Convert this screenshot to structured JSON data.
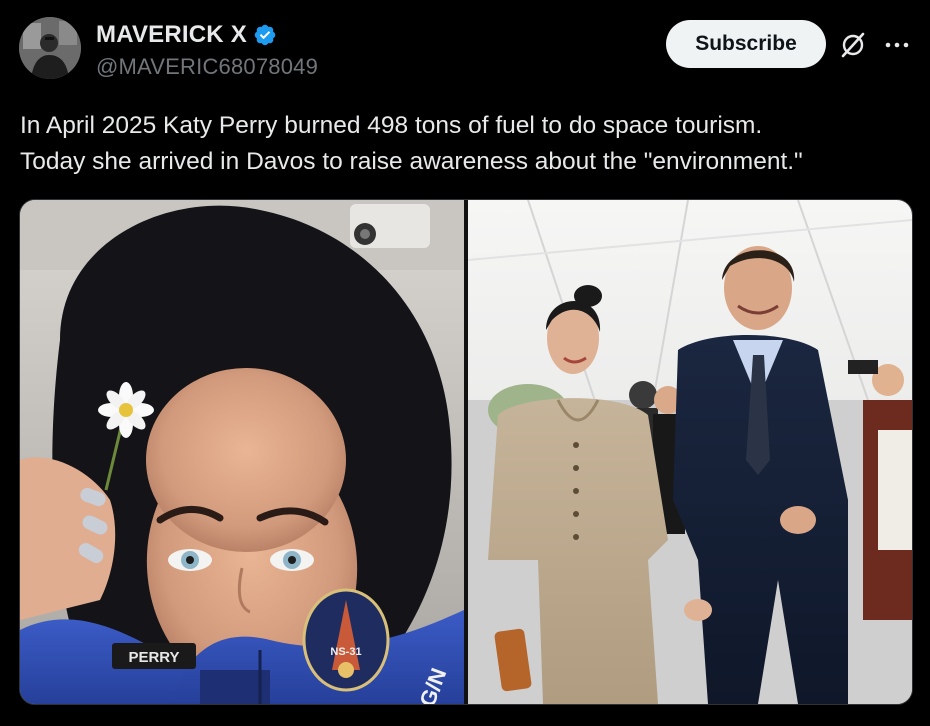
{
  "post": {
    "author": {
      "display_name": "MAVERICK X",
      "handle": "@MAVERIC68078049",
      "verified": true
    },
    "subscribe_label": "Subscribe",
    "text_lines": [
      "In April 2025 Katy Perry burned 498 tons of fuel to do space tourism.",
      "Today she arrived in Davos to raise awareness about the \"environment.\""
    ],
    "media": {
      "left_photo": {
        "name_patch": "PERRY",
        "mission_patch_text": "NS-31",
        "suit_text": "G/N"
      },
      "right_photo": {}
    }
  },
  "icons": {
    "verified": "verified-badge-icon",
    "grok": "grok-icon",
    "more": "more-horizontal-icon"
  },
  "colors": {
    "background": "#000000",
    "text_primary": "#e7e9ea",
    "text_secondary": "#71767b",
    "verified_blue": "#1d9bf0",
    "subscribe_bg": "#eff3f4"
  }
}
